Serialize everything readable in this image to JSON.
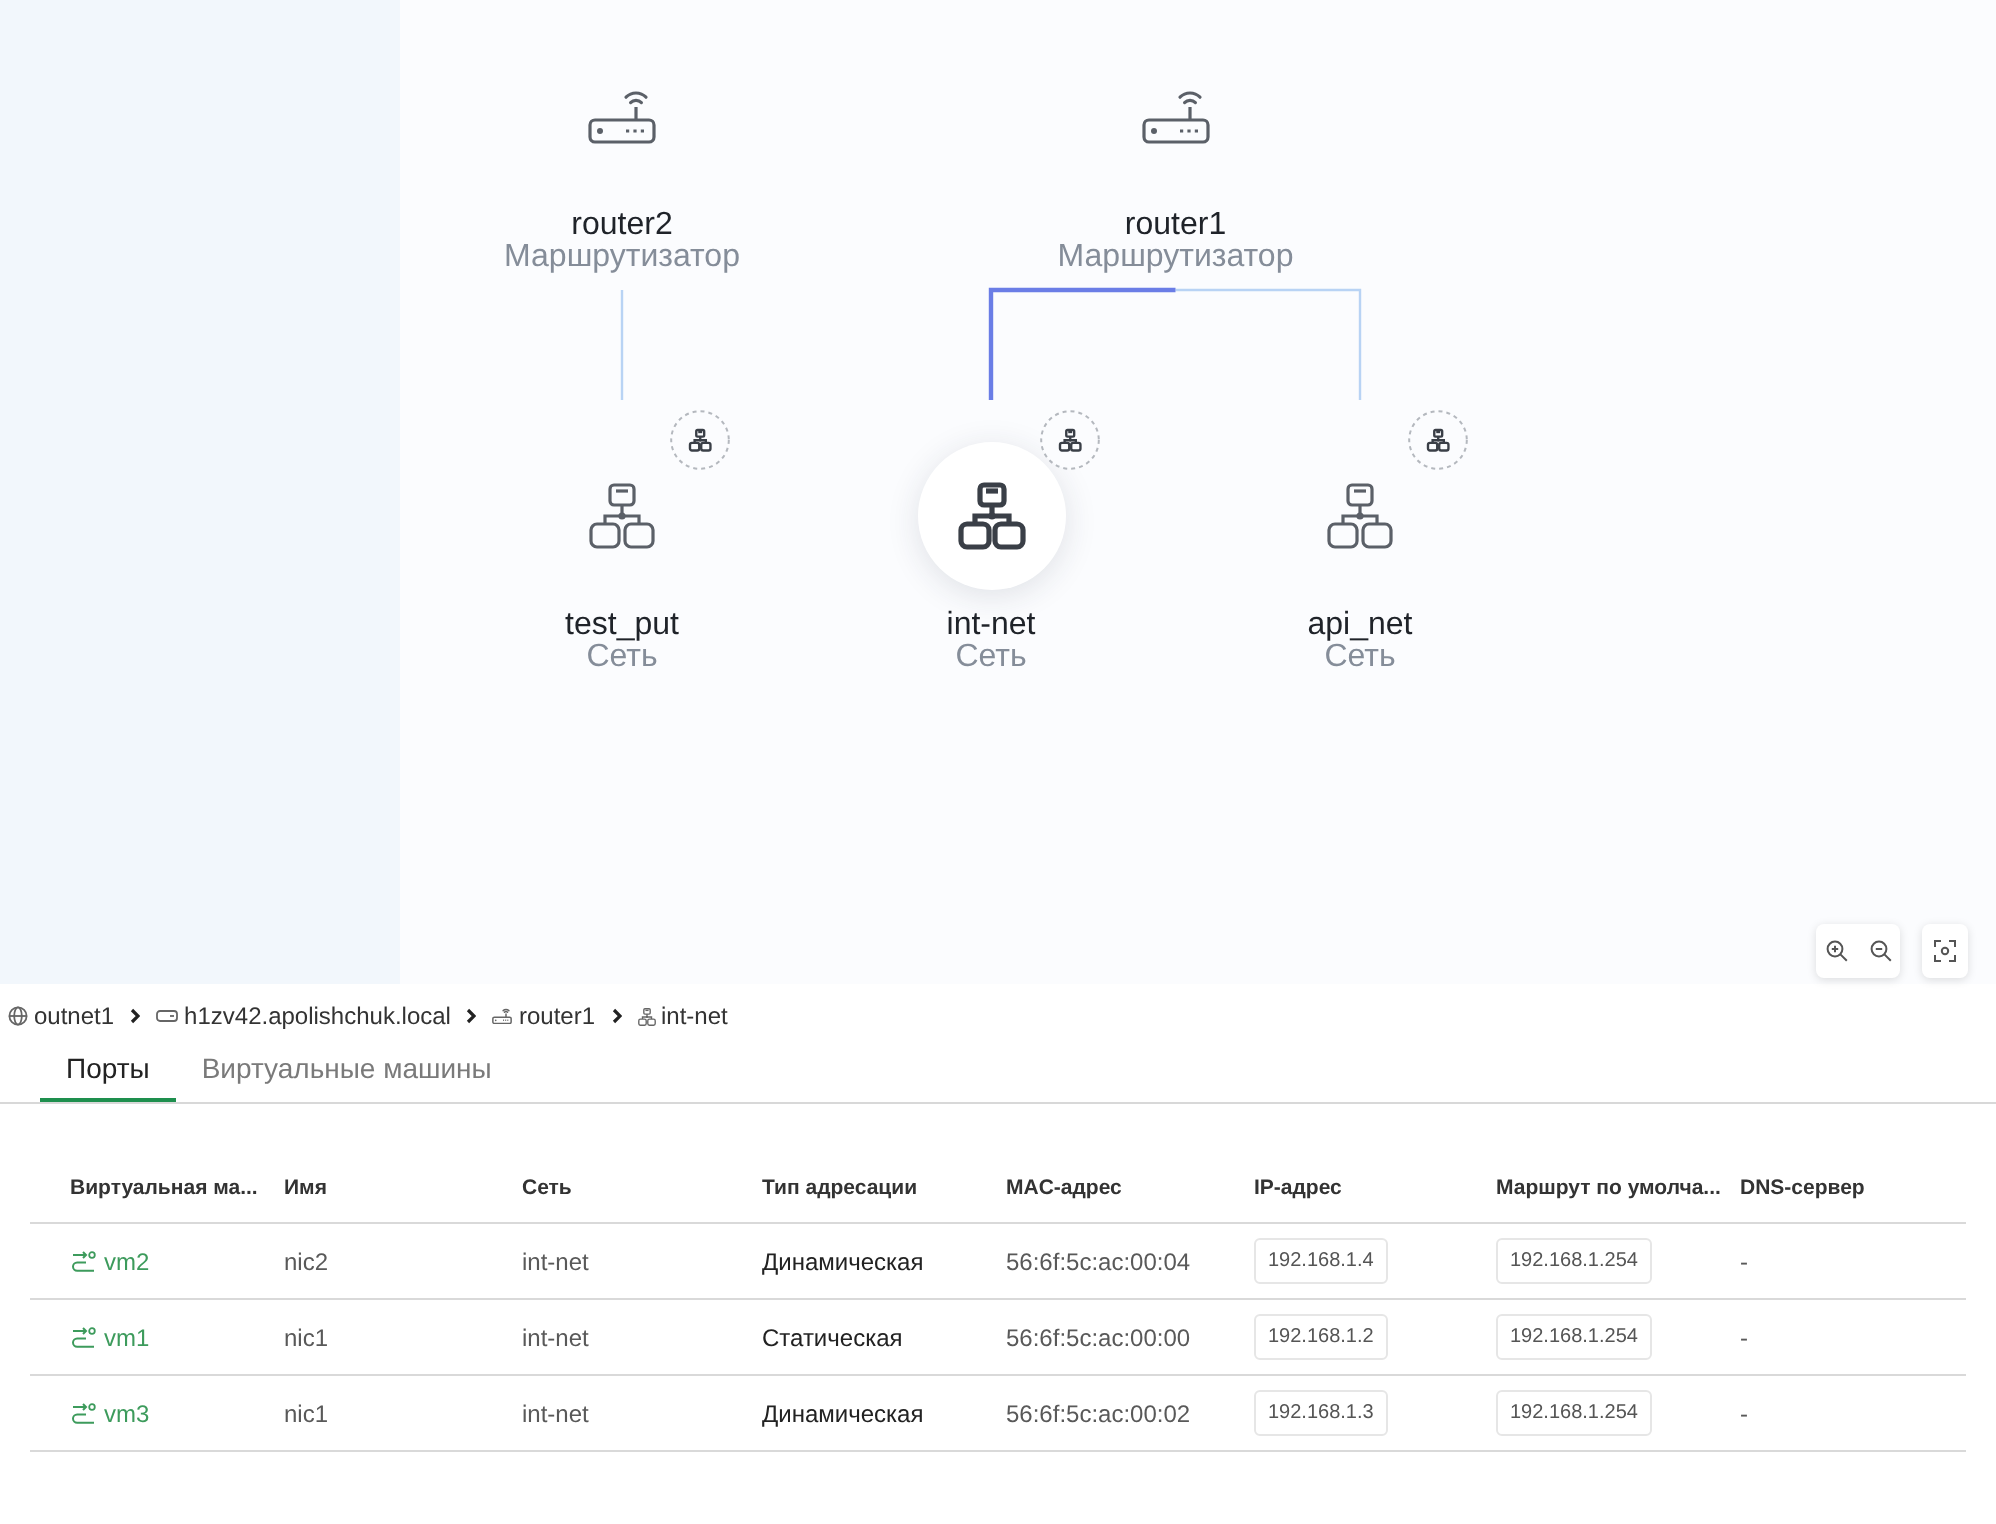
{
  "topology": {
    "nodes": [
      {
        "kind": "router",
        "name": "router2",
        "type": "Маршрутизатор",
        "selected": false,
        "children": [
          {
            "kind": "network",
            "name": "test_put",
            "type": "Сеть",
            "selected": false
          }
        ]
      },
      {
        "kind": "router",
        "name": "router1",
        "type": "Маршрутизатор",
        "selected": false,
        "children": [
          {
            "kind": "network",
            "name": "int-net",
            "type": "Сеть",
            "selected": true
          },
          {
            "kind": "network",
            "name": "api_net",
            "type": "Сеть",
            "selected": false
          }
        ]
      }
    ]
  },
  "breadcrumb": [
    {
      "kind": "zone",
      "label": "outnet1"
    },
    {
      "kind": "host",
      "label": "h1zv42.apolishchuk.local"
    },
    {
      "kind": "router",
      "label": "router1"
    },
    {
      "kind": "network",
      "label": "int-net"
    }
  ],
  "tabs": [
    {
      "label": "Порты",
      "selected": true
    },
    {
      "label": "Виртуальные машины",
      "selected": false
    }
  ],
  "table": {
    "columns": [
      {
        "label": "Виртуальная ма...",
        "kind": "link"
      },
      {
        "label": "Имя",
        "kind": "muted"
      },
      {
        "label": "Сеть",
        "kind": "muted"
      },
      {
        "label": "Тип адресации",
        "kind": "text"
      },
      {
        "label": "MAC-адрес",
        "kind": "muted"
      },
      {
        "label": "IP-адрес",
        "kind": "chip"
      },
      {
        "label": "Маршрут по умолча...",
        "kind": "chip"
      },
      {
        "label": "DNS-сервер",
        "kind": "muted"
      }
    ],
    "rows": [
      [
        "vm2",
        "nic2",
        "int-net",
        "Динамическая",
        "56:6f:5c:ac:00:04",
        "192.168.1.4",
        "192.168.1.254",
        "-"
      ],
      [
        "vm1",
        "nic1",
        "int-net",
        "Статическая",
        "56:6f:5c:ac:00:00",
        "192.168.1.2",
        "192.168.1.254",
        "-"
      ],
      [
        "vm3",
        "nic1",
        "int-net",
        "Динамическая",
        "56:6f:5c:ac:00:02",
        "192.168.1.3",
        "192.168.1.254",
        "-"
      ]
    ]
  }
}
